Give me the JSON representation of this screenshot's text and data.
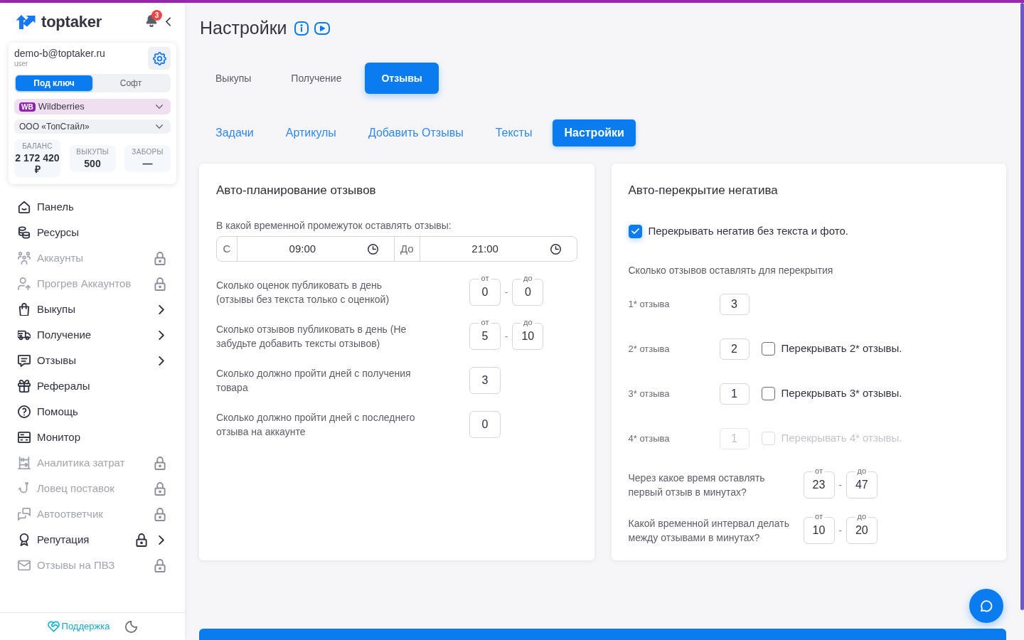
{
  "sidebar": {
    "logo": {
      "text": "toptaker"
    },
    "notifications": {
      "count": "3"
    },
    "account": {
      "email": "demo-b@toptaker.ru",
      "role": "user"
    },
    "mode_switch": [
      {
        "label": "Под ключ",
        "selected": true
      },
      {
        "label": "Софт",
        "selected": false
      }
    ],
    "marketplace_select": {
      "badge": "WB",
      "value": "Wildberries"
    },
    "company_select": {
      "value": "ООО «ТопСтайл»"
    },
    "stats": [
      {
        "label": "БАЛАНС",
        "value": "2 172 420 ₽"
      },
      {
        "label": "ВЫКУПЫ",
        "value": "500"
      },
      {
        "label": "ЗАБОРЫ",
        "value": "—"
      }
    ],
    "nav": [
      {
        "label": "Панель",
        "disabled": false,
        "locked": false,
        "expandable": false
      },
      {
        "label": "Ресурсы",
        "disabled": false,
        "locked": false,
        "expandable": false
      },
      {
        "label": "Аккаунты",
        "disabled": true,
        "locked": true,
        "expandable": false
      },
      {
        "label": "Прогрев Аккаунтов",
        "disabled": true,
        "locked": true,
        "expandable": false
      },
      {
        "label": "Выкупы",
        "disabled": false,
        "locked": false,
        "expandable": true
      },
      {
        "label": "Получение",
        "disabled": false,
        "locked": false,
        "expandable": true
      },
      {
        "label": "Отзывы",
        "disabled": false,
        "locked": false,
        "expandable": true
      },
      {
        "label": "Рефералы",
        "disabled": false,
        "locked": false,
        "expandable": false
      },
      {
        "label": "Помощь",
        "disabled": false,
        "locked": false,
        "expandable": false
      },
      {
        "label": "Монитор",
        "disabled": false,
        "locked": false,
        "expandable": false
      },
      {
        "label": "Аналитика затрат",
        "disabled": true,
        "locked": true,
        "expandable": false
      },
      {
        "label": "Ловец поставок",
        "disabled": true,
        "locked": true,
        "expandable": false
      },
      {
        "label": "Автоответчик",
        "disabled": true,
        "locked": true,
        "expandable": false
      },
      {
        "label": "Репутация",
        "disabled": false,
        "locked": true,
        "expandable": true
      },
      {
        "label": "Отзывы на ПВЗ",
        "disabled": true,
        "locked": true,
        "expandable": false
      }
    ],
    "footer": {
      "support": "Поддержка"
    }
  },
  "page": {
    "title": "Настройки"
  },
  "tabs": [
    {
      "label": "Выкупы",
      "selected": false
    },
    {
      "label": "Получение",
      "selected": false
    },
    {
      "label": "Отзывы",
      "selected": true
    }
  ],
  "subtabs": [
    {
      "label": "Задачи",
      "selected": false
    },
    {
      "label": "Артикулы",
      "selected": false
    },
    {
      "label": "Добавить Отзывы",
      "selected": false
    },
    {
      "label": "Тексты",
      "selected": false
    },
    {
      "label": "Настройки",
      "selected": true
    }
  ],
  "schedule_card": {
    "title": "Авто-планирование отзывов",
    "time_range": {
      "label": "В какой временной промежуток оставлять отзывы:",
      "from_prefix": "С",
      "from": "09:00",
      "to_prefix": "До",
      "to": "21:00"
    },
    "rows": [
      {
        "kind": "range",
        "label": "Сколько оценок публиковать в день (отзывы без текста только с оценкой)",
        "from_label": "от",
        "from": "0",
        "separator": "-",
        "to_label": "до",
        "to": "0"
      },
      {
        "kind": "range",
        "label": "Сколько отзывов публиковать в день (Не забудьте добавить тексты отзывов)",
        "from_label": "от",
        "from": "5",
        "separator": "-",
        "to_label": "до",
        "to": "10"
      },
      {
        "kind": "single",
        "label": "Сколько должно пройти дней с получения товара",
        "value": "3"
      },
      {
        "kind": "single",
        "label": "Сколько должно пройти дней с последнего отзыва на аккаунте",
        "value": "0"
      }
    ]
  },
  "negative_card": {
    "title": "Авто-перекрытие негатива",
    "cover_option": {
      "label": "Перекрывать негатив без текста и фото.",
      "checked": true
    },
    "counts_label": "Сколько отзывов оставлять для перекрытия",
    "star_rows": [
      {
        "label": "1* отзыва",
        "value": "3",
        "disabled": false
      },
      {
        "label": "2* отзыва",
        "value": "2",
        "disabled": false,
        "option": {
          "label": "Перекрывать 2* отзывы.",
          "checked": false
        }
      },
      {
        "label": "3* отзыва",
        "value": "1",
        "disabled": false,
        "option": {
          "label": "Перекрывать 3* отзывы.",
          "checked": false
        }
      },
      {
        "label": "4* отзыва",
        "value": "1",
        "disabled": true,
        "option": {
          "label": "Перекрывать 4* отзывы.",
          "checked": false
        }
      }
    ],
    "timing_rows": [
      {
        "label": "Через какое время оставлять первый отзыв в минутах?",
        "from_label": "от",
        "from": "23",
        "separator": "-",
        "to_label": "до",
        "to": "47"
      },
      {
        "label": "Какой временной интервал делать между отзывами в минутах?",
        "from_label": "от",
        "from": "10",
        "separator": "-",
        "to_label": "до",
        "to": "20"
      }
    ]
  }
}
